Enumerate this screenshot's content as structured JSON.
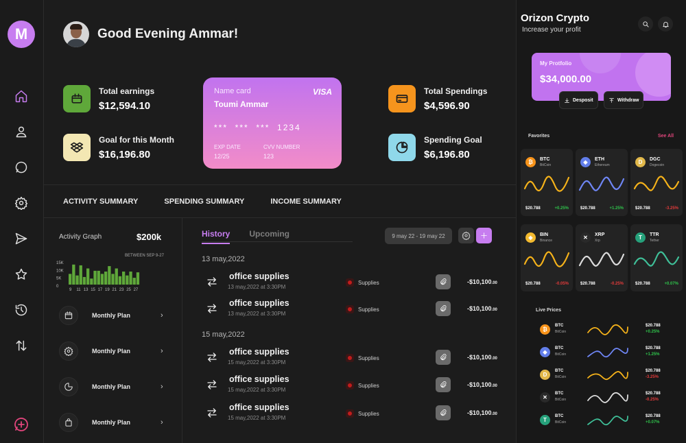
{
  "logo": {
    "letter": "M"
  },
  "user": {
    "greeting": "Good Evening Ammar!"
  },
  "stats": {
    "total_earnings": {
      "label": "Total earnings",
      "value": "$12,594.10",
      "color": "#5fa83a"
    },
    "goal_month": {
      "label": "Goal for this Month",
      "value": "$16,196.80",
      "color": "#f3e7b3"
    },
    "total_spendings": {
      "label": "Total Spendings",
      "value": "$4,596.90",
      "color": "#f5941d"
    },
    "spending_goal": {
      "label": "Spending Goal",
      "value": "$6,196.80",
      "color": "#8fd8ea"
    }
  },
  "card": {
    "name_label": "Name card",
    "name": "Toumi Ammar",
    "brand": "VISA",
    "number": "***  ***  ***  1234",
    "exp_label": "EXP DATE",
    "exp_value": "12/25",
    "cvv_label": "CVV NUMBER",
    "cvv_value": "123"
  },
  "tabs": [
    "ACTIVITY SUMMARY",
    "SPENDING SUMMARY",
    "INCOME SUMMARY"
  ],
  "activity": {
    "label": "Activity Graph",
    "value": "$200k",
    "sub": "BETWEEN SEP 9-27",
    "y_ticks": [
      "15K",
      "10K",
      "5K",
      "0"
    ],
    "chart_data": {
      "type": "bar",
      "title": "Activity Graph",
      "categories": [
        "9",
        "9",
        "11",
        "11",
        "13",
        "13",
        "15",
        "15",
        "17",
        "17",
        "19",
        "19",
        "21",
        "21",
        "23",
        "23",
        "25",
        "25",
        "27",
        "27"
      ],
      "x_ticks": [
        "9",
        "11",
        "13",
        "15",
        "17",
        "19",
        "21",
        "23",
        "25",
        "27"
      ],
      "values": [
        12,
        24,
        10,
        23,
        8,
        19,
        6,
        16,
        16,
        12,
        15,
        22,
        12,
        19,
        9,
        15,
        10,
        15,
        7,
        14
      ],
      "ylim": [
        0,
        15
      ]
    }
  },
  "plans": [
    {
      "label": "Monthly Plan",
      "icon": "calendar-icon"
    },
    {
      "label": "Monthly Plan",
      "icon": "gear-icon"
    },
    {
      "label": "Monthly Plan",
      "icon": "pie-chart-icon"
    },
    {
      "label": "Monthly Plan",
      "icon": "shopping-bag-icon"
    }
  ],
  "history": {
    "tab_history": "History",
    "tab_upcoming": "Upcoming",
    "date_range": "9 may 22 - 19 may 22",
    "groups": [
      {
        "date": "13 may,2022",
        "items": [
          {
            "title": "office supplies",
            "date": "13 may,2022 at 3:30PM",
            "category": "Supplies",
            "amount": "-$10,100",
            "cents": ".00"
          },
          {
            "title": "office supplies",
            "date": "13 may,2022 at 3:30PM",
            "category": "Supplies",
            "amount": "-$10,100",
            "cents": ".00"
          }
        ]
      },
      {
        "date": "15 may,2022",
        "items": [
          {
            "title": "office supplies",
            "date": "15 may,2022 at 3:30PM",
            "category": "Supplies",
            "amount": "-$10,100",
            "cents": ".00"
          },
          {
            "title": "office supplies",
            "date": "15 may,2022 at 3:30PM",
            "category": "Supplies",
            "amount": "-$10,100",
            "cents": ".00"
          },
          {
            "title": "office supplies",
            "date": "15 may,2022 at 3:30PM",
            "category": "Supplies",
            "amount": "-$10,100",
            "cents": ".00"
          }
        ]
      }
    ]
  },
  "right": {
    "title": "Orizon Crypto",
    "subtitle": "Increase your profit",
    "portfolio_label": "My Protfolio",
    "portfolio_value": "$34,000.00",
    "deposit": "Desposit",
    "withdraw": "Withdraw",
    "favorites_label": "Favorites",
    "see_all": "See All",
    "live_label": "Live Prices",
    "favorites": [
      {
        "sym": "BTC",
        "name": "BitCoin",
        "price": "$20.788",
        "change": "+0.25%",
        "dir": "pos",
        "color": "#f7931a",
        "line": "#f5b21a",
        "glyph": "₿"
      },
      {
        "sym": "ETH",
        "name": "Ethereum",
        "price": "$20.788",
        "change": "+1.25%",
        "dir": "pos",
        "color": "#627eea",
        "line": "#6f86f5",
        "glyph": "◆"
      },
      {
        "sym": "DGC",
        "name": "Dogecoin",
        "price": "$20.788",
        "change": "-3.25%",
        "dir": "neg",
        "color": "#e1b84a",
        "line": "#f5b21a",
        "glyph": "D"
      },
      {
        "sym": "BIN",
        "name": "Binance",
        "price": "$20.788",
        "change": "-0.05%",
        "dir": "neg",
        "color": "#f3ba2f",
        "line": "#f5b21a",
        "glyph": "◈"
      },
      {
        "sym": "XRP",
        "name": "Xrp",
        "price": "$20.788",
        "change": "-0.25%",
        "dir": "neg",
        "color": "#2a2a2a",
        "line": "#dcdcdc",
        "glyph": "✕"
      },
      {
        "sym": "TTR",
        "name": "Tether",
        "price": "$20.788",
        "change": "+0.07%",
        "dir": "pos",
        "color": "#26a17b",
        "line": "#3fbf98",
        "glyph": "T"
      }
    ],
    "live": [
      {
        "sym": "BTC",
        "name": "BitCoin",
        "price": "$20.788",
        "change": "+0.25%",
        "dir": "pos",
        "color": "#f7931a",
        "line": "#f5b21a",
        "glyph": "₿"
      },
      {
        "sym": "BTC",
        "name": "BitCoin",
        "price": "$20.788",
        "change": "+1.25%",
        "dir": "pos",
        "color": "#627eea",
        "line": "#6f86f5",
        "glyph": "◆"
      },
      {
        "sym": "BTC",
        "name": "BitCoin",
        "price": "$20.788",
        "change": "-3.25%",
        "dir": "neg",
        "color": "#e1b84a",
        "line": "#f5b21a",
        "glyph": "D"
      },
      {
        "sym": "BTC",
        "name": "BitCoin",
        "price": "$20.788",
        "change": "-0.25%",
        "dir": "neg",
        "color": "#2a2a2a",
        "line": "#dcdcdc",
        "glyph": "✕"
      },
      {
        "sym": "BTC",
        "name": "BitCoin",
        "price": "$20.788",
        "change": "+0.07%",
        "dir": "pos",
        "color": "#26a17b",
        "line": "#3fbf98",
        "glyph": "T"
      }
    ]
  }
}
